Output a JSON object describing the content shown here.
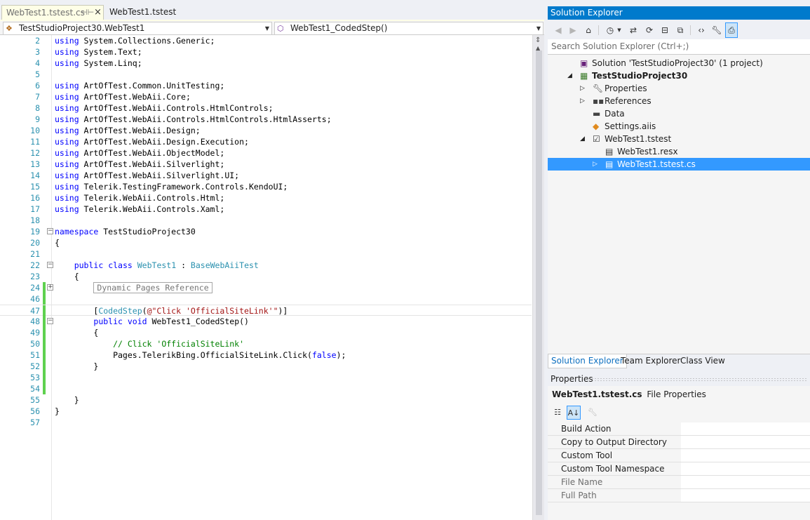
{
  "editor": {
    "tabs": [
      {
        "label": "WebTest1.tstest.cs",
        "pin_glyph": "⊣⊢",
        "close_glyph": "×"
      },
      {
        "label": "WebTest1.tstest"
      }
    ],
    "nav_left": "TestStudioProject30.WebTest1",
    "nav_right": "WebTest1_CodedStep()",
    "lines": [
      {
        "n": "2",
        "code": "using System.Collections.Generic;"
      },
      {
        "n": "3",
        "code": "using System.Text;"
      },
      {
        "n": "4",
        "code": "using System.Linq;"
      },
      {
        "n": "5",
        "code": ""
      },
      {
        "n": "6",
        "code": "using ArtOfTest.Common.UnitTesting;"
      },
      {
        "n": "7",
        "code": "using ArtOfTest.WebAii.Core;"
      },
      {
        "n": "8",
        "code": "using ArtOfTest.WebAii.Controls.HtmlControls;"
      },
      {
        "n": "9",
        "code": "using ArtOfTest.WebAii.Controls.HtmlControls.HtmlAsserts;"
      },
      {
        "n": "10",
        "code": "using ArtOfTest.WebAii.Design;"
      },
      {
        "n": "11",
        "code": "using ArtOfTest.WebAii.Design.Execution;"
      },
      {
        "n": "12",
        "code": "using ArtOfTest.WebAii.ObjectModel;"
      },
      {
        "n": "13",
        "code": "using ArtOfTest.WebAii.Silverlight;"
      },
      {
        "n": "14",
        "code": "using ArtOfTest.WebAii.Silverlight.UI;"
      },
      {
        "n": "15",
        "code": "using Telerik.TestingFramework.Controls.KendoUI;"
      },
      {
        "n": "16",
        "code": "using Telerik.WebAii.Controls.Html;"
      },
      {
        "n": "17",
        "code": "using Telerik.WebAii.Controls.Xaml;"
      },
      {
        "n": "18",
        "code": ""
      },
      {
        "n": "19",
        "code": "namespace TestStudioProject30"
      },
      {
        "n": "20",
        "code": "{"
      },
      {
        "n": "21",
        "code": ""
      },
      {
        "n": "22",
        "code": "    public class WebTest1 : BaseWebAiiTest"
      },
      {
        "n": "23",
        "code": "    {"
      },
      {
        "n": "24",
        "code": "        Dynamic Pages Reference"
      },
      {
        "n": "46",
        "code": ""
      },
      {
        "n": "47",
        "code": "        [CodedStep(@\"Click 'OfficialSiteLink'\")]"
      },
      {
        "n": "48",
        "code": "        public void WebTest1_CodedStep()"
      },
      {
        "n": "49",
        "code": "        {"
      },
      {
        "n": "50",
        "code": "            // Click 'OfficialSiteLink'"
      },
      {
        "n": "51",
        "code": "            Pages.TelerikBing.OfficialSiteLink.Click(false);"
      },
      {
        "n": "52",
        "code": "        }"
      },
      {
        "n": "53",
        "code": ""
      },
      {
        "n": "54",
        "code": ""
      },
      {
        "n": "55",
        "code": "    }"
      },
      {
        "n": "56",
        "code": "}"
      },
      {
        "n": "57",
        "code": ""
      }
    ],
    "syntax_colors": {
      "keyword": "#0000ff",
      "type": "#2b91af",
      "string": "#a31515",
      "comment": "#008000",
      "line_number": "#2b91af",
      "changed_bar": "#5fd14f"
    }
  },
  "solution_explorer": {
    "title": "Solution Explorer",
    "search_placeholder": "Search Solution Explorer (Ctrl+;)",
    "toolbar": [
      "back-icon",
      "forward-icon",
      "home-icon",
      "history-icon",
      "sync-icon",
      "refresh-icon",
      "collapse-all-icon",
      "copy-icon",
      "view-code-icon",
      "properties-wrench-icon",
      "preview-icon"
    ],
    "tree": [
      {
        "label": "Solution 'TestStudioProject30' (1 project)",
        "icon": "solution-icon",
        "expander": ""
      },
      {
        "label": "TestStudioProject30",
        "icon": "project-icon",
        "expander": "◢",
        "bold": true
      },
      {
        "label": "Properties",
        "icon": "wrench-icon",
        "expander": "▷"
      },
      {
        "label": "References",
        "icon": "references-icon",
        "expander": "▷"
      },
      {
        "label": "Data",
        "icon": "folder-icon",
        "expander": ""
      },
      {
        "label": "Settings.aiis",
        "icon": "settings-icon",
        "expander": ""
      },
      {
        "label": "WebTest1.tstest",
        "icon": "test-file-icon",
        "expander": "◢"
      },
      {
        "label": "WebTest1.resx",
        "icon": "resx-file-icon",
        "expander": ""
      },
      {
        "label": "WebTest1.tstest.cs",
        "icon": "cs-file-icon",
        "expander": "▷",
        "selected": true
      }
    ],
    "tabs": [
      "Solution Explorer",
      "Team Explorer",
      "Class View"
    ],
    "accent": "#007acc",
    "selection": "#3399ff"
  },
  "properties": {
    "title": "Properties",
    "object_name": "WebTest1.tstest.cs",
    "object_type": "File Properties",
    "rows": [
      {
        "name": "Build Action",
        "dim": false
      },
      {
        "name": "Copy to Output Directory",
        "dim": false
      },
      {
        "name": "Custom Tool",
        "dim": false
      },
      {
        "name": "Custom Tool Namespace",
        "dim": false
      },
      {
        "name": "File Name",
        "dim": true
      },
      {
        "name": "Full Path",
        "dim": true
      }
    ]
  }
}
